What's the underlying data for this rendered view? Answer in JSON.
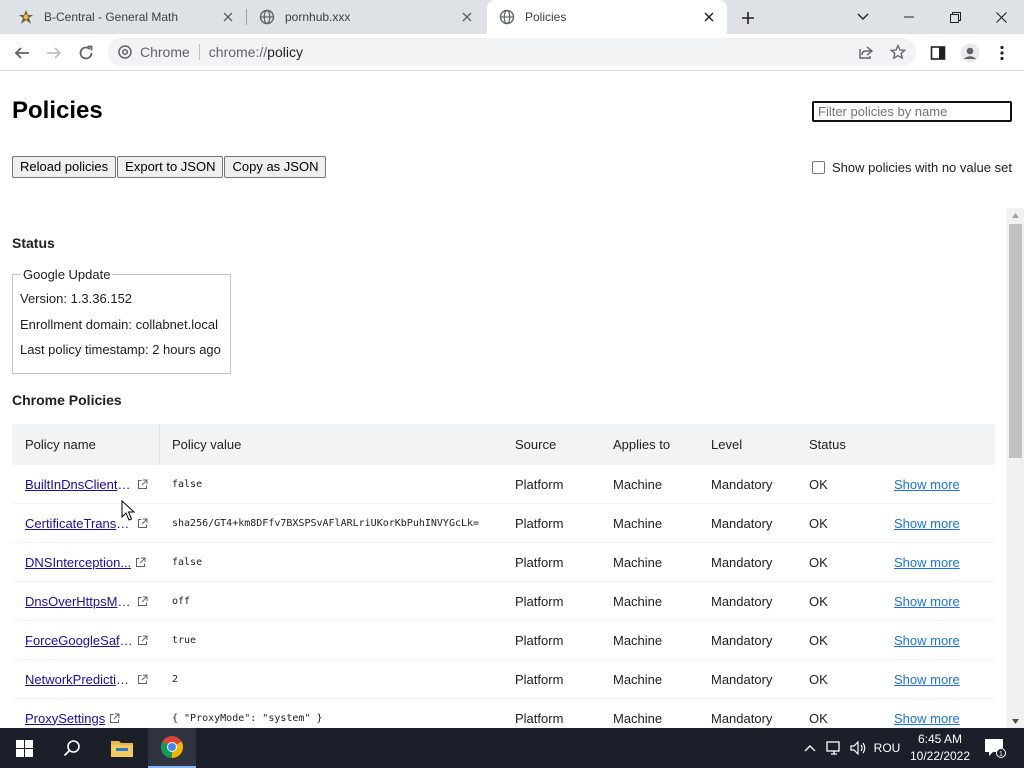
{
  "tabs": [
    {
      "title": "B-Central - General Math",
      "favicon": "b-central-icon"
    },
    {
      "title": "pornhub.xxx",
      "favicon": "globe-icon"
    },
    {
      "title": "Policies",
      "favicon": "globe-icon",
      "active": true
    }
  ],
  "omnibox": {
    "chip": "Chrome",
    "url_scheme": "chrome://",
    "url_host": "policy"
  },
  "page": {
    "title": "Policies",
    "filter_placeholder": "Filter policies by name",
    "buttons": {
      "reload": "Reload policies",
      "export": "Export to JSON",
      "copy": "Copy as JSON"
    },
    "show_no_value": "Show policies with no value set"
  },
  "status": {
    "heading": "Status",
    "box_title": "Google Update",
    "version": "Version: 1.3.36.152",
    "enrollment": "Enrollment domain: collabnet.local",
    "timestamp": "Last policy timestamp: 2 hours ago"
  },
  "chrome_policies": {
    "heading": "Chrome Policies",
    "columns": {
      "name": "Policy name",
      "value": "Policy value",
      "source": "Source",
      "applies": "Applies to",
      "level": "Level",
      "status": "Status"
    },
    "rows": [
      {
        "name": "BuiltInDnsClientE...",
        "value": "false",
        "source": "Platform",
        "applies": "Machine",
        "level": "Mandatory",
        "status": "OK",
        "more": "Show more"
      },
      {
        "name": "CertificateTransp...",
        "value": "sha256/GT4+km8DFfv7BXSPSvAFlARLriUKorKbPuhINVYGcLk=",
        "source": "Platform",
        "applies": "Machine",
        "level": "Mandatory",
        "status": "OK",
        "more": "Show more"
      },
      {
        "name": "DNSInterception...",
        "value": "false",
        "source": "Platform",
        "applies": "Machine",
        "level": "Mandatory",
        "status": "OK",
        "more": "Show more"
      },
      {
        "name": "DnsOverHttpsMo...",
        "value": "off",
        "source": "Platform",
        "applies": "Machine",
        "level": "Mandatory",
        "status": "OK",
        "more": "Show more"
      },
      {
        "name": "ForceGoogleSafe...",
        "value": "true",
        "source": "Platform",
        "applies": "Machine",
        "level": "Mandatory",
        "status": "OK",
        "more": "Show more"
      },
      {
        "name": "NetworkPredictio...",
        "value": "2",
        "source": "Platform",
        "applies": "Machine",
        "level": "Mandatory",
        "status": "OK",
        "more": "Show more"
      },
      {
        "name": "ProxySettings",
        "value": "{ \"ProxyMode\": \"system\" }",
        "source": "Platform",
        "applies": "Machine",
        "level": "Mandatory",
        "status": "OK",
        "more": "Show more"
      }
    ]
  },
  "taskbar": {
    "language": "ROU",
    "time": "6:45 AM",
    "date": "10/22/2022",
    "notification_count": "1"
  }
}
